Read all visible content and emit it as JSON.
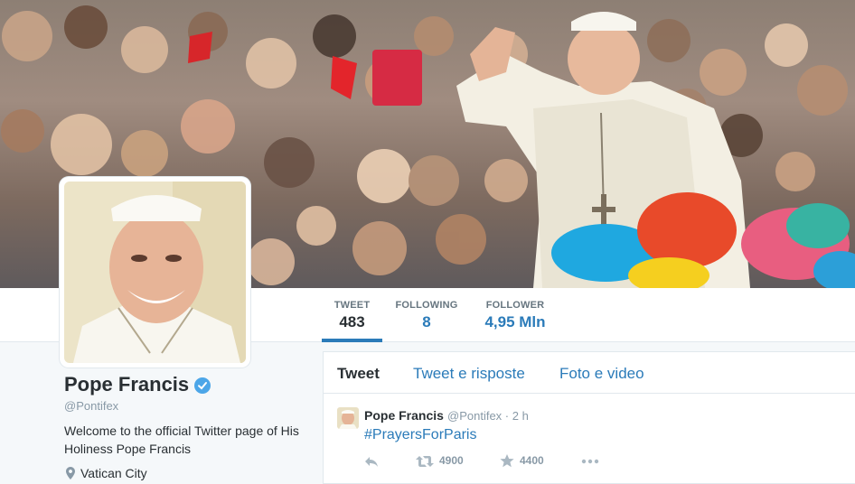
{
  "profile": {
    "name": "Pope Francis",
    "handle": "@Pontifex",
    "bio": "Welcome to the official Twitter page of His Holiness Pope Francis",
    "location": "Vatican City"
  },
  "stats": [
    {
      "label": "TWEET",
      "value": "483"
    },
    {
      "label": "FOLLOWING",
      "value": "8"
    },
    {
      "label": "FOLLOWER",
      "value": "4,95 Mln"
    }
  ],
  "tabs": [
    "Tweet",
    "Tweet e risposte",
    "Foto e video"
  ],
  "tweet": {
    "author": "Pope Francis",
    "meta": "@Pontifex · 2 h",
    "text": "#PrayersForParis",
    "retweets": "4900",
    "favorites": "4400"
  },
  "icons": {
    "verified": "verified-badge-icon",
    "location": "location-pin-icon",
    "reply": "reply-icon",
    "retweet": "retweet-icon",
    "favorite": "star-icon",
    "more": "more-dots-icon"
  },
  "colors": {
    "accent": "#2b7bb9",
    "text": "#292f33",
    "muted": "#8899a6",
    "background": "#f5f8fa"
  }
}
